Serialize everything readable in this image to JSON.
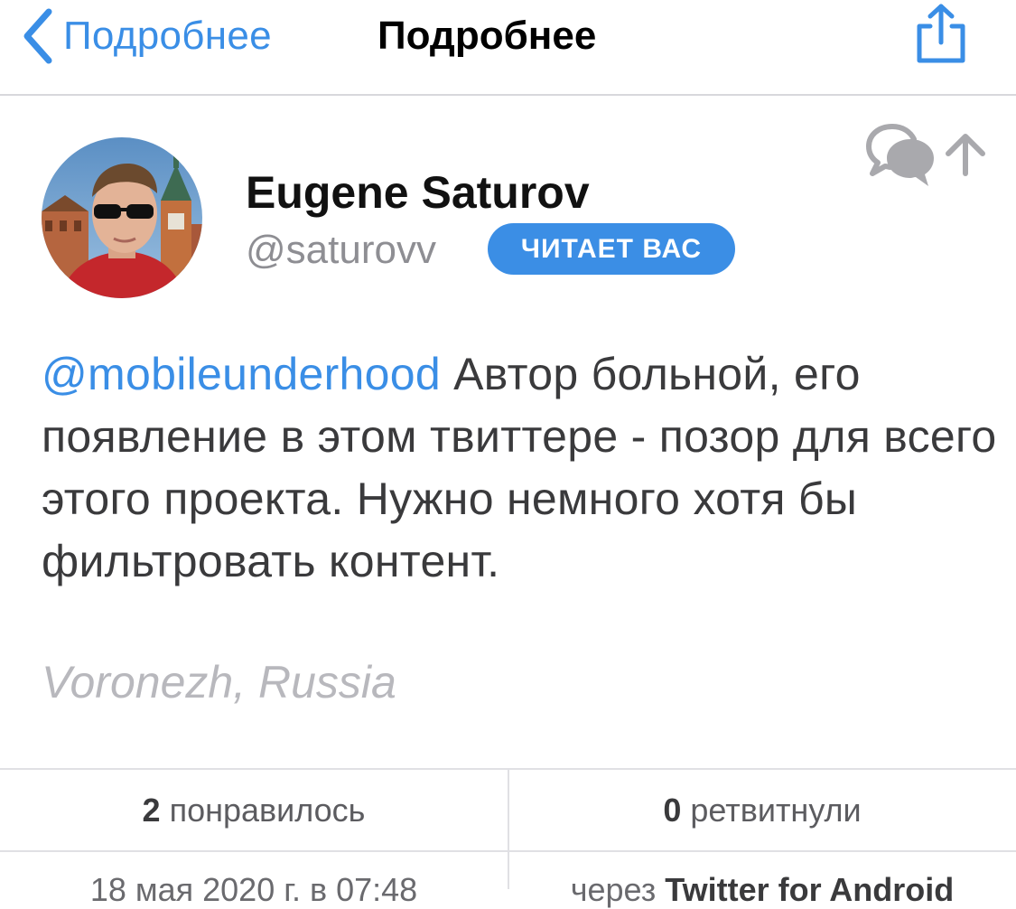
{
  "nav": {
    "back_label": "Подробнее",
    "title": "Подробнее",
    "back_icon": "chevron-left-icon",
    "share_icon": "share-icon"
  },
  "author": {
    "name": "Eugene Saturov",
    "handle": "@saturovv",
    "follows_badge": "ЧИТАЕТ ВАС"
  },
  "header_icons": {
    "reply_icon": "speech-bubbles-icon",
    "parent_icon": "arrow-up-icon"
  },
  "tweet": {
    "mention": "@mobileunderhood",
    "text": " Автор больной, его появление в этом твиттере - позор для всего этого проекта. Нужно немного хотя бы фильтровать контент.",
    "location": "Voronezh, Russia"
  },
  "stats": {
    "likes_count": "2",
    "likes_label": "понравилось",
    "retweets_count": "0",
    "retweets_label": "ретвитнули"
  },
  "meta": {
    "date": "18 мая 2020 г. в 07:48",
    "via_prefix": "через",
    "client": "Twitter for Android"
  },
  "colors": {
    "accent": "#3a8ee6",
    "badge": "#3b8ee5",
    "icon_gray": "#a9a9ad",
    "location_gray": "#b8b8bd"
  }
}
